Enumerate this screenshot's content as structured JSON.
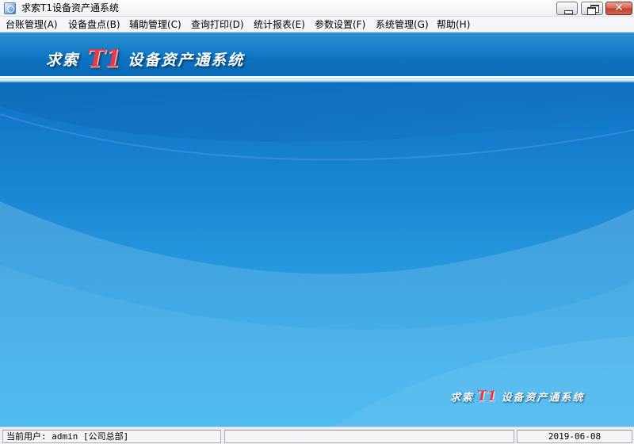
{
  "window": {
    "title": "求索T1设备资产通系统",
    "icon": "app-icon",
    "controls": {
      "minimize_icon": "minimize-icon",
      "maximize_icon": "restore-icon",
      "close_glyph": "✕"
    }
  },
  "menu": {
    "items": [
      {
        "label": "台账管理(A)"
      },
      {
        "label": "设备盘点(B)"
      },
      {
        "label": "辅助管理(C)"
      },
      {
        "label": "查询打印(D)"
      },
      {
        "label": "统计报表(E)"
      },
      {
        "label": "参数设置(F)"
      },
      {
        "label": "系统管理(G)"
      },
      {
        "label": "帮助(H)"
      }
    ]
  },
  "banner": {
    "lead": "求索",
    "accent": "T1",
    "rest": "设备资产通系统",
    "accent_color": "#e6394a"
  },
  "watermark": {
    "lead": "求索",
    "accent": "T1",
    "rest": "设备资产通系统"
  },
  "statusbar": {
    "user": "当前用户: admin [公司总部]",
    "middle": "",
    "date": "2019-06-08"
  },
  "colors": {
    "banner_blue": "#0c72c0",
    "desktop_blue": "#1985d3",
    "desktop_light": "#44b7ef"
  }
}
